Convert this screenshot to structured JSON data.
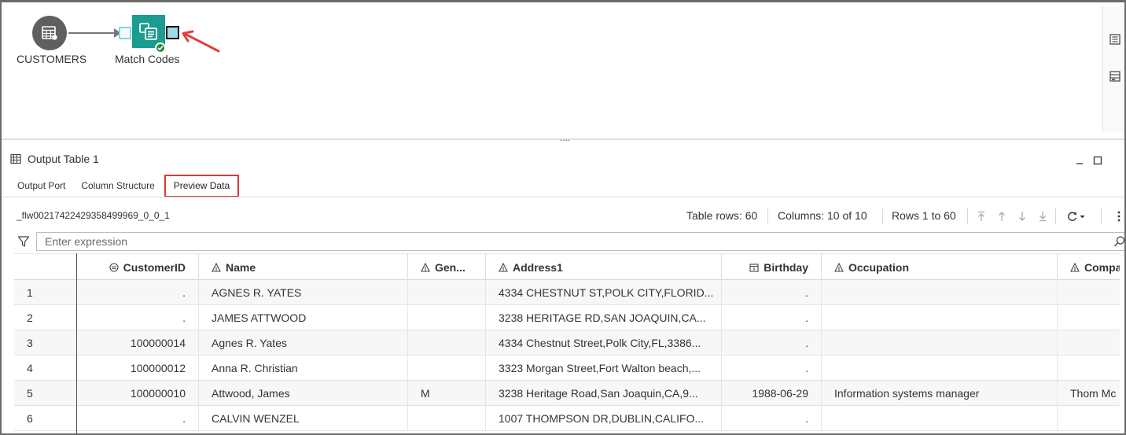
{
  "flow": {
    "source_node_label": "CUSTOMERS",
    "match_node_label": "Match Codes"
  },
  "panel": {
    "title": "Output Table 1",
    "tabs": [
      {
        "label": "Output Port",
        "active": false
      },
      {
        "label": "Column Structure",
        "active": false
      },
      {
        "label": "Preview Data",
        "active": true
      }
    ]
  },
  "info_bar": {
    "table_name": "_flw00217422429358499969_0_0_1",
    "table_rows": "Table rows: 60",
    "columns": "Columns: 10 of 10",
    "rows_range": "Rows 1 to 60"
  },
  "filter": {
    "placeholder": "Enter expression",
    "value": ""
  },
  "grid": {
    "columns": [
      {
        "label": "",
        "icon": ""
      },
      {
        "label": "CustomerID",
        "icon": "numeric-icon"
      },
      {
        "label": "Name",
        "icon": "character-icon"
      },
      {
        "label": "Gen...",
        "icon": "character-icon"
      },
      {
        "label": "Address1",
        "icon": "character-icon"
      },
      {
        "label": "Birthday",
        "icon": "date-icon"
      },
      {
        "label": "Occupation",
        "icon": "character-icon"
      },
      {
        "label": "Compa",
        "icon": "character-icon"
      }
    ],
    "rows": [
      [
        "1",
        ".",
        "AGNES R. YATES",
        "",
        "4334 CHESTNUT ST,POLK CITY,FLORID...",
        ".",
        "",
        ""
      ],
      [
        "2",
        ".",
        "JAMES ATTWOOD",
        "",
        "3238 HERITAGE RD,SAN JOAQUIN,CA...",
        ".",
        "",
        ""
      ],
      [
        "3",
        "100000014",
        "Agnes R. Yates",
        "",
        "4334 Chestnut Street,Polk City,FL,3386...",
        ".",
        "",
        ""
      ],
      [
        "4",
        "100000012",
        "Anna R. Christian",
        "",
        "3323 Morgan Street,Fort Walton beach,...",
        ".",
        "",
        ""
      ],
      [
        "5",
        "100000010",
        "Attwood, James",
        "M",
        "3238 Heritage Road,San Joaquin,CA,9...",
        "1988-06-29",
        "Information systems manager",
        "Thom Mc"
      ],
      [
        "6",
        ".",
        "CALVIN WENZEL",
        "",
        "1007 THOMPSON DR,DUBLIN,CALIFO...",
        ".",
        "",
        ""
      ]
    ]
  },
  "colors": {
    "node_gray": "#5f5f5f",
    "node_teal": "#1a9c90",
    "status_green": "#2a8a3c",
    "annotation_red": "#e04040",
    "port_cyan": "#9fdbe3"
  }
}
